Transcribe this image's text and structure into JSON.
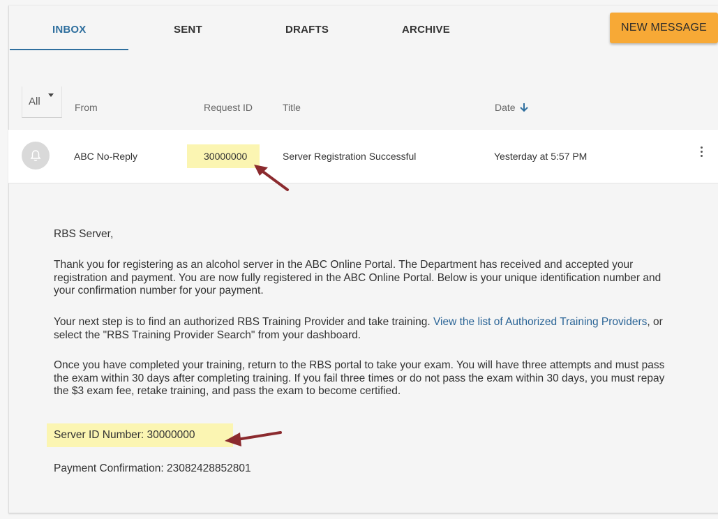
{
  "tabs": [
    {
      "label": "INBOX",
      "active": true
    },
    {
      "label": "SENT",
      "active": false
    },
    {
      "label": "DRAFTS",
      "active": false
    },
    {
      "label": "ARCHIVE",
      "active": false
    }
  ],
  "new_message_label": "NEW MESSAGE",
  "filter": {
    "selected": "All"
  },
  "columns": {
    "from": "From",
    "request_id": "Request ID",
    "title": "Title",
    "date": "Date"
  },
  "message": {
    "from": "ABC No-Reply",
    "request_id": "30000000",
    "title": "Server Registration Successful",
    "date": "Yesterday at 5:57 PM",
    "greeting": "RBS Server,",
    "p1": "Thank you for registering as an alcohol server in the ABC Online Portal. The Department has received and accepted your registration and payment. You are now fully registered in the ABC Online Portal. Below is your unique identification number and your confirmation number for your payment.",
    "p2_before": "Your next step is to find an authorized RBS Training Provider and take training. ",
    "p2_link": "View the list of Authorized Training Providers",
    "p2_after": ", or select the \"RBS Training Provider Search\" from your dashboard.",
    "p3": "Once you have completed your training, return to the RBS portal to take your exam. You will have three attempts and must pass the exam within 30 days after completing training. If you fail three times or do not pass the exam within 30 days, you must repay the $3 exam fee, retake training, and pass the exam to become certified.",
    "server_id": "Server ID Number: 30000000",
    "payment_confirmation": "Payment Confirmation: 23082428852801"
  },
  "colors": {
    "accent": "#2f6f9e",
    "button": "#f7a936",
    "highlight": "#fbf5b2",
    "annotation_arrow": "#8b2a2e"
  },
  "icons": {
    "avatar": "bell-icon",
    "sort": "arrow-down-icon",
    "menu": "kebab-menu-icon"
  }
}
